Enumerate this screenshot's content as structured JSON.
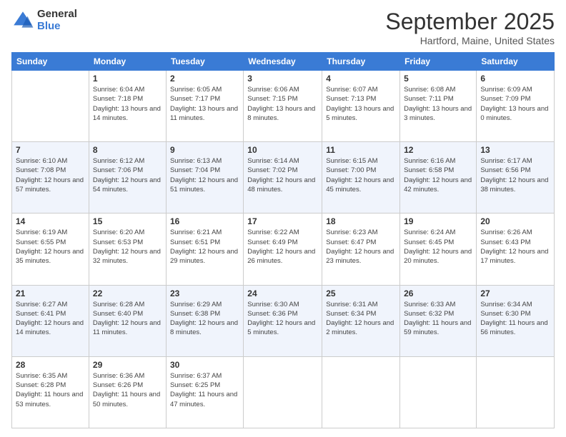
{
  "logo": {
    "general": "General",
    "blue": "Blue"
  },
  "header": {
    "month": "September 2025",
    "location": "Hartford, Maine, United States"
  },
  "days_of_week": [
    "Sunday",
    "Monday",
    "Tuesday",
    "Wednesday",
    "Thursday",
    "Friday",
    "Saturday"
  ],
  "weeks": [
    [
      {
        "day": "",
        "sunrise": "",
        "sunset": "",
        "daylight": ""
      },
      {
        "day": "1",
        "sunrise": "Sunrise: 6:04 AM",
        "sunset": "Sunset: 7:18 PM",
        "daylight": "Daylight: 13 hours and 14 minutes."
      },
      {
        "day": "2",
        "sunrise": "Sunrise: 6:05 AM",
        "sunset": "Sunset: 7:17 PM",
        "daylight": "Daylight: 13 hours and 11 minutes."
      },
      {
        "day": "3",
        "sunrise": "Sunrise: 6:06 AM",
        "sunset": "Sunset: 7:15 PM",
        "daylight": "Daylight: 13 hours and 8 minutes."
      },
      {
        "day": "4",
        "sunrise": "Sunrise: 6:07 AM",
        "sunset": "Sunset: 7:13 PM",
        "daylight": "Daylight: 13 hours and 5 minutes."
      },
      {
        "day": "5",
        "sunrise": "Sunrise: 6:08 AM",
        "sunset": "Sunset: 7:11 PM",
        "daylight": "Daylight: 13 hours and 3 minutes."
      },
      {
        "day": "6",
        "sunrise": "Sunrise: 6:09 AM",
        "sunset": "Sunset: 7:09 PM",
        "daylight": "Daylight: 13 hours and 0 minutes."
      }
    ],
    [
      {
        "day": "7",
        "sunrise": "Sunrise: 6:10 AM",
        "sunset": "Sunset: 7:08 PM",
        "daylight": "Daylight: 12 hours and 57 minutes."
      },
      {
        "day": "8",
        "sunrise": "Sunrise: 6:12 AM",
        "sunset": "Sunset: 7:06 PM",
        "daylight": "Daylight: 12 hours and 54 minutes."
      },
      {
        "day": "9",
        "sunrise": "Sunrise: 6:13 AM",
        "sunset": "Sunset: 7:04 PM",
        "daylight": "Daylight: 12 hours and 51 minutes."
      },
      {
        "day": "10",
        "sunrise": "Sunrise: 6:14 AM",
        "sunset": "Sunset: 7:02 PM",
        "daylight": "Daylight: 12 hours and 48 minutes."
      },
      {
        "day": "11",
        "sunrise": "Sunrise: 6:15 AM",
        "sunset": "Sunset: 7:00 PM",
        "daylight": "Daylight: 12 hours and 45 minutes."
      },
      {
        "day": "12",
        "sunrise": "Sunrise: 6:16 AM",
        "sunset": "Sunset: 6:58 PM",
        "daylight": "Daylight: 12 hours and 42 minutes."
      },
      {
        "day": "13",
        "sunrise": "Sunrise: 6:17 AM",
        "sunset": "Sunset: 6:56 PM",
        "daylight": "Daylight: 12 hours and 38 minutes."
      }
    ],
    [
      {
        "day": "14",
        "sunrise": "Sunrise: 6:19 AM",
        "sunset": "Sunset: 6:55 PM",
        "daylight": "Daylight: 12 hours and 35 minutes."
      },
      {
        "day": "15",
        "sunrise": "Sunrise: 6:20 AM",
        "sunset": "Sunset: 6:53 PM",
        "daylight": "Daylight: 12 hours and 32 minutes."
      },
      {
        "day": "16",
        "sunrise": "Sunrise: 6:21 AM",
        "sunset": "Sunset: 6:51 PM",
        "daylight": "Daylight: 12 hours and 29 minutes."
      },
      {
        "day": "17",
        "sunrise": "Sunrise: 6:22 AM",
        "sunset": "Sunset: 6:49 PM",
        "daylight": "Daylight: 12 hours and 26 minutes."
      },
      {
        "day": "18",
        "sunrise": "Sunrise: 6:23 AM",
        "sunset": "Sunset: 6:47 PM",
        "daylight": "Daylight: 12 hours and 23 minutes."
      },
      {
        "day": "19",
        "sunrise": "Sunrise: 6:24 AM",
        "sunset": "Sunset: 6:45 PM",
        "daylight": "Daylight: 12 hours and 20 minutes."
      },
      {
        "day": "20",
        "sunrise": "Sunrise: 6:26 AM",
        "sunset": "Sunset: 6:43 PM",
        "daylight": "Daylight: 12 hours and 17 minutes."
      }
    ],
    [
      {
        "day": "21",
        "sunrise": "Sunrise: 6:27 AM",
        "sunset": "Sunset: 6:41 PM",
        "daylight": "Daylight: 12 hours and 14 minutes."
      },
      {
        "day": "22",
        "sunrise": "Sunrise: 6:28 AM",
        "sunset": "Sunset: 6:40 PM",
        "daylight": "Daylight: 12 hours and 11 minutes."
      },
      {
        "day": "23",
        "sunrise": "Sunrise: 6:29 AM",
        "sunset": "Sunset: 6:38 PM",
        "daylight": "Daylight: 12 hours and 8 minutes."
      },
      {
        "day": "24",
        "sunrise": "Sunrise: 6:30 AM",
        "sunset": "Sunset: 6:36 PM",
        "daylight": "Daylight: 12 hours and 5 minutes."
      },
      {
        "day": "25",
        "sunrise": "Sunrise: 6:31 AM",
        "sunset": "Sunset: 6:34 PM",
        "daylight": "Daylight: 12 hours and 2 minutes."
      },
      {
        "day": "26",
        "sunrise": "Sunrise: 6:33 AM",
        "sunset": "Sunset: 6:32 PM",
        "daylight": "Daylight: 11 hours and 59 minutes."
      },
      {
        "day": "27",
        "sunrise": "Sunrise: 6:34 AM",
        "sunset": "Sunset: 6:30 PM",
        "daylight": "Daylight: 11 hours and 56 minutes."
      }
    ],
    [
      {
        "day": "28",
        "sunrise": "Sunrise: 6:35 AM",
        "sunset": "Sunset: 6:28 PM",
        "daylight": "Daylight: 11 hours and 53 minutes."
      },
      {
        "day": "29",
        "sunrise": "Sunrise: 6:36 AM",
        "sunset": "Sunset: 6:26 PM",
        "daylight": "Daylight: 11 hours and 50 minutes."
      },
      {
        "day": "30",
        "sunrise": "Sunrise: 6:37 AM",
        "sunset": "Sunset: 6:25 PM",
        "daylight": "Daylight: 11 hours and 47 minutes."
      },
      {
        "day": "",
        "sunrise": "",
        "sunset": "",
        "daylight": ""
      },
      {
        "day": "",
        "sunrise": "",
        "sunset": "",
        "daylight": ""
      },
      {
        "day": "",
        "sunrise": "",
        "sunset": "",
        "daylight": ""
      },
      {
        "day": "",
        "sunrise": "",
        "sunset": "",
        "daylight": ""
      }
    ]
  ]
}
